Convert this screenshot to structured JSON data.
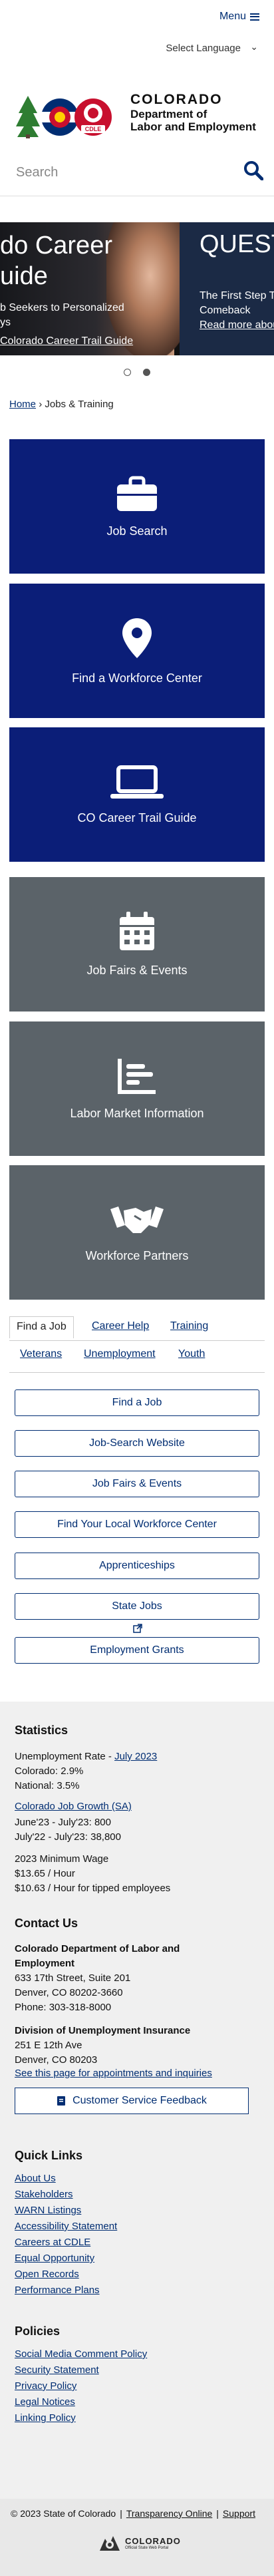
{
  "header": {
    "menu_label": "Menu",
    "language_label": "Select Language",
    "logo_line1": "COLORADO",
    "logo_line2": "Department of",
    "logo_line3": "Labor and Employment",
    "logo_badge": "CDLE"
  },
  "search": {
    "placeholder": "Search"
  },
  "carousel": {
    "slide1_heading_line1": "do Career",
    "slide1_heading_line2": "uide",
    "slide1_text_line1": "b Seekers to Personalized",
    "slide1_text_line2": "ys",
    "slide1_link": "Colorado Career Trail Guide",
    "slide2_heading": "QUEST",
    "slide2_text_line1": "The First Step T",
    "slide2_text_line2": "Comeback",
    "slide2_link": "Read more abou"
  },
  "breadcrumb": {
    "home": "Home",
    "sep": "›",
    "current": "Jobs & Training"
  },
  "tiles": [
    {
      "label": "Job Search",
      "icon": "briefcase-icon",
      "color": "#0b1e78"
    },
    {
      "label": "Find a Workforce Center",
      "icon": "map-pin-icon",
      "color": "#0b1e78"
    },
    {
      "label": "CO Career Trail Guide",
      "icon": "laptop-icon",
      "color": "#0b1e78"
    },
    {
      "label": "Job Fairs & Events",
      "icon": "calendar-icon",
      "color": "#5b6369"
    },
    {
      "label": "Labor Market Information",
      "icon": "chart-icon",
      "color": "#5b6369"
    },
    {
      "label": "Workforce Partners",
      "icon": "handshake-icon",
      "color": "#5b6369"
    }
  ],
  "tabs": [
    "Find a Job",
    "Career Help",
    "Training",
    "Veterans",
    "Unemployment",
    "Youth"
  ],
  "buttons": [
    "Find a Job",
    "Job-Search Website",
    "Job Fairs & Events",
    "Find Your Local Workforce Center",
    "Apprenticeships",
    "State Jobs",
    "Employment Grants"
  ],
  "footer": {
    "stats_heading": "Statistics",
    "unemp_label": "Unemployment Rate - ",
    "unemp_link": "July 2023",
    "colorado": "Colorado: 2.9%",
    "national": "National: 3.5%",
    "growth_link": "Colorado Job Growth (SA)",
    "growth_1": "June'23 - July'23: 800",
    "growth_2": "July'22 - July'23: 38,800",
    "wage_label": "2023 Minimum Wage",
    "wage_1": "$13.65 / Hour",
    "wage_2": "$10.63 / Hour for tipped employees",
    "contact_heading": "Contact Us",
    "dept_line1": "Colorado Department of Labor and",
    "dept_line2": "Employment",
    "addr1": "633 17th Street, Suite 201",
    "addr2": "Denver, CO  80202-3660",
    "phone": "Phone: 303-318-8000",
    "ui_heading": "Division of Unemployment Insurance",
    "ui_addr1": "251 E 12th Ave",
    "ui_addr2": "Denver, CO  80203",
    "ui_link": "See this page for appointments and inquiries",
    "feedback_btn": "Customer Service Feedback",
    "quick_heading": "Quick Links",
    "quick_links": [
      "About Us",
      "Stakeholders",
      "WARN Listings",
      "Accessibility Statement",
      "Careers at CDLE",
      "Equal Opportunity",
      "Open Records",
      "Performance Plans"
    ],
    "policies_heading": "Policies",
    "policies": [
      "Social Media Comment Policy",
      "Security Statement",
      "Privacy Policy",
      "Legal Notices",
      "Linking Policy"
    ],
    "copyright": "© 2023 State of Colorado",
    "transparency": "Transparency Online",
    "support": "Support",
    "bottom_logo": "COLORADO",
    "bottom_logo_sub": "Official State Web Portal"
  }
}
